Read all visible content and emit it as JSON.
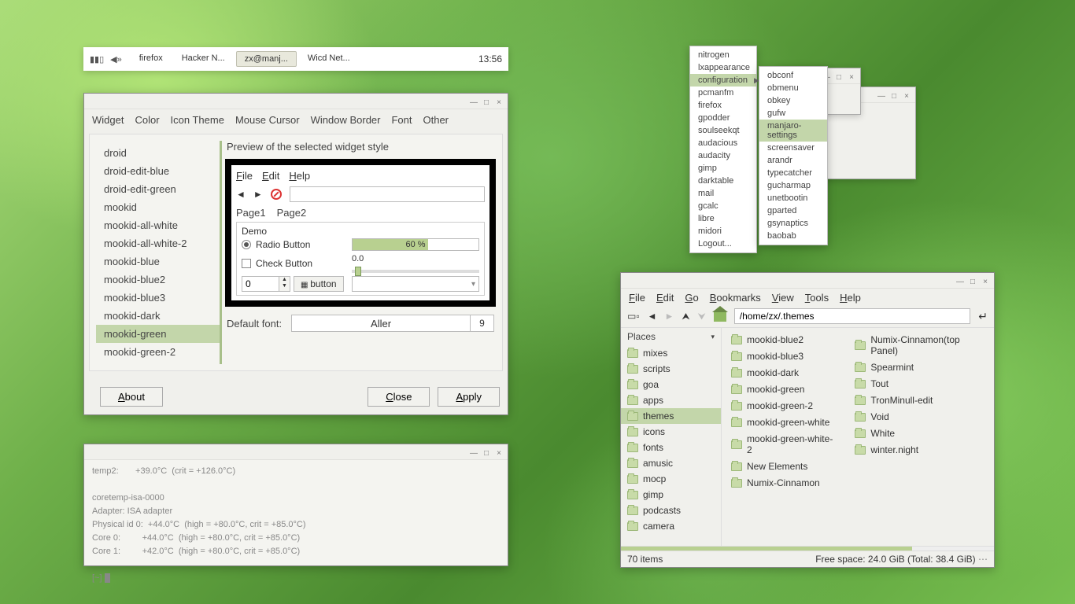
{
  "taskbar": {
    "items": [
      {
        "label": "firefox",
        "active": false
      },
      {
        "label": "Hacker N...",
        "active": false
      },
      {
        "label": "zx@manj...",
        "active": true
      },
      {
        "label": "Wicd Net...",
        "active": false
      }
    ],
    "clock": "13:56"
  },
  "lx": {
    "tabs": [
      "Widget",
      "Color",
      "Icon Theme",
      "Mouse Cursor",
      "Window Border",
      "Font",
      "Other"
    ],
    "themes": [
      "droid",
      "droid-edit-blue",
      "droid-edit-green",
      "mookid",
      "mookid-all-white",
      "mookid-all-white-2",
      "mookid-blue",
      "mookid-blue2",
      "mookid-blue3",
      "mookid-dark",
      "mookid-green",
      "mookid-green-2"
    ],
    "selected": "mookid-green",
    "preview_header": "Preview of the selected widget style",
    "preview": {
      "menu": [
        "File",
        "Edit",
        "Help"
      ],
      "tabs": [
        "Page1",
        "Page2"
      ],
      "demo_label": "Demo",
      "radio_label": "Radio Button",
      "check_label": "Check Button",
      "spin_value": "0",
      "button_label": "button",
      "progress_text": "60 %",
      "scale_value": "0.0"
    },
    "font_label": "Default font:",
    "font_name": "Aller",
    "font_size": "9",
    "buttons": {
      "about": "About",
      "close": "Close",
      "apply": "Apply"
    }
  },
  "terminal": {
    "text": "temp2:       +39.0°C  (crit = +126.0°C)\n\ncoretemp-isa-0000\nAdapter: ISA adapter\nPhysical id 0:  +44.0°C  (high = +80.0°C, crit = +85.0°C)\nCore 0:         +44.0°C  (high = +80.0°C, crit = +85.0°C)\nCore 1:         +42.0°C  (high = +80.0°C, crit = +85.0°C)\n\n[~] "
  },
  "ctx1": {
    "items": [
      "nitrogen",
      "lxappearance",
      "configuration",
      "pcmanfm",
      "firefox",
      "gpodder",
      "soulseekqt",
      "audacious",
      "audacity",
      "gimp",
      "darktable",
      "mail",
      "gcalc",
      "libre",
      "midori",
      "Logout..."
    ],
    "highlight": "configuration",
    "submenu_on": "configuration"
  },
  "ctx2": {
    "items": [
      "obconf",
      "obmenu",
      "obkey",
      "gufw",
      "manjaro-settings",
      "screensaver",
      "arandr",
      "typecatcher",
      "gucharmap",
      "unetbootin",
      "gparted",
      "gsynaptics",
      "baobab"
    ],
    "highlight": "manjaro-settings"
  },
  "fm": {
    "menu": [
      "File",
      "Edit",
      "Go",
      "Bookmarks",
      "View",
      "Tools",
      "Help"
    ],
    "path": "/home/zx/.themes",
    "places_header": "Places",
    "places": [
      "mixes",
      "scripts",
      "goa",
      "apps",
      "themes",
      "icons",
      "fonts",
      "amusic",
      "mocp",
      "gimp",
      "podcasts",
      "camera"
    ],
    "places_selected": "themes",
    "files_cols": [
      [
        "mookid-blue2",
        "mookid-blue3",
        "mookid-dark",
        "mookid-green",
        "mookid-green-2",
        "mookid-green-white",
        "mookid-green-white-2",
        "New Elements",
        "Numix-Cinnamon"
      ],
      [
        "Numix-Cinnamon(top Panel)",
        "Spearmint",
        "Tout",
        "TronMinull-edit",
        "Void",
        "White",
        "winter.night"
      ]
    ],
    "status_left": "70 items",
    "status_right": "Free space: 24.0 GiB (Total: 38.4 GiB)"
  }
}
